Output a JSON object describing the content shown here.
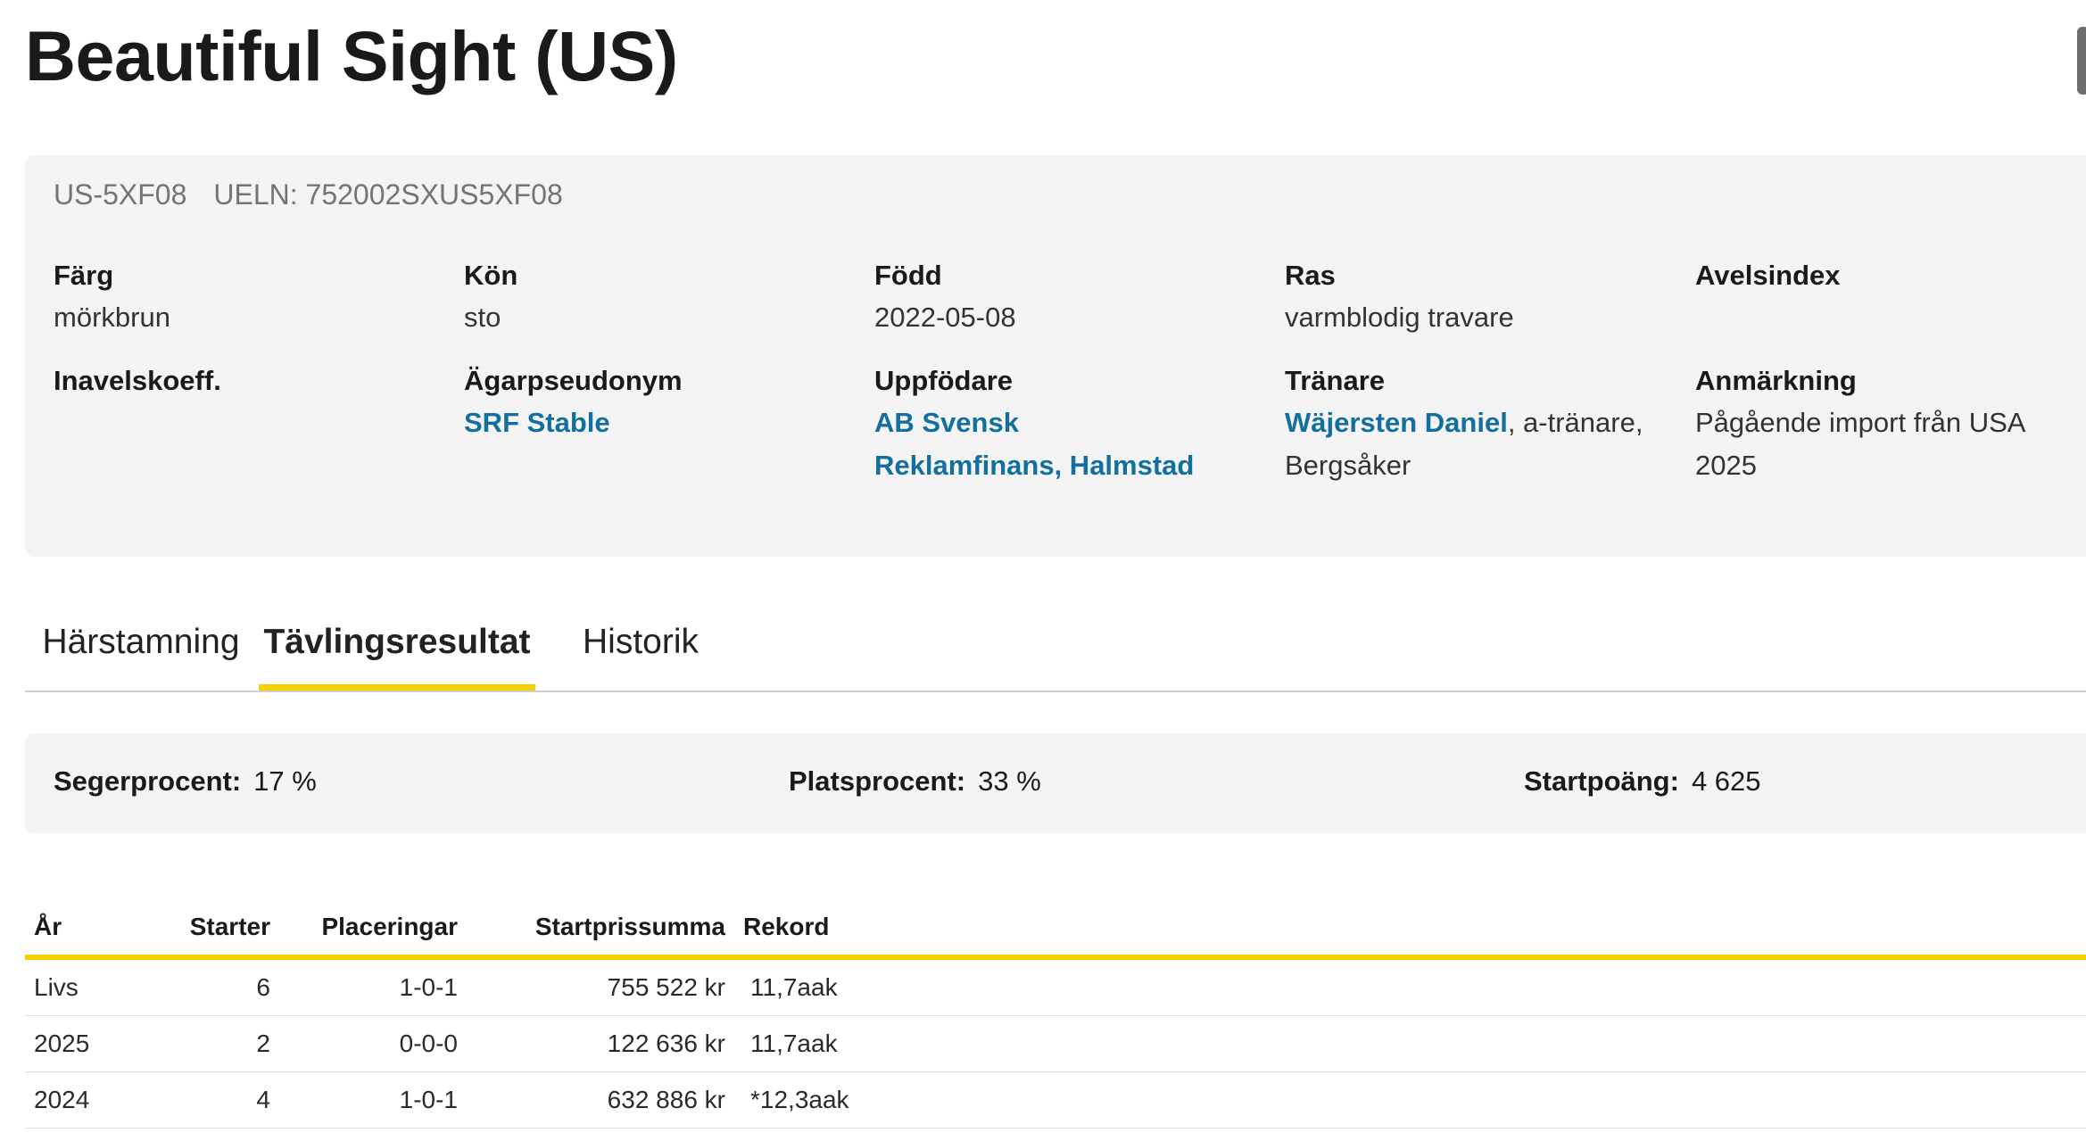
{
  "horse": {
    "name": "Beautiful Sight (US)",
    "reg_no": "US-5XF08",
    "ueln": "UELN: 752002SXUS5XF08"
  },
  "details": {
    "farg": {
      "label": "Färg",
      "value": "mörkbrun"
    },
    "kon": {
      "label": "Kön",
      "value": "sto"
    },
    "fodd": {
      "label": "Född",
      "value": "2022-05-08"
    },
    "ras": {
      "label": "Ras",
      "value": "varmblodig travare"
    },
    "avelsindex": {
      "label": "Avelsindex",
      "value": ""
    },
    "inavel": {
      "label": "Inavelskoeff.",
      "value": ""
    },
    "agarpseudonym": {
      "label": "Ägarpseudonym",
      "link": "SRF Stable"
    },
    "uppfodare": {
      "label": "Uppfödare",
      "link": "AB Svensk Reklamfinans, Halmstad"
    },
    "tranare": {
      "label": "Tränare",
      "link": "Wäjersten Daniel",
      "suffix": ", a-tränare, Bergsåker"
    },
    "anmarkning": {
      "label": "Anmärkning",
      "value": "Pågående import från USA 2025"
    }
  },
  "tabs": [
    "Härstamning",
    "Tävlingsresultat",
    "Historik"
  ],
  "active_tab": "Tävlingsresultat",
  "stats": {
    "seger": {
      "label": "Segerprocent:",
      "value": "17 %"
    },
    "plats": {
      "label": "Platsprocent:",
      "value": "33 %"
    },
    "startpoang": {
      "label": "Startpoäng:",
      "value": "4 625"
    }
  },
  "table": {
    "headers": [
      "År",
      "Starter",
      "Placeringar",
      "Startprissumma",
      "Rekord"
    ],
    "rows": [
      [
        "Livs",
        "6",
        "1-0-1",
        "755 522 kr",
        "11,7aak"
      ],
      [
        "2025",
        "2",
        "0-0-0",
        "122 636 kr",
        "11,7aak"
      ],
      [
        "2024",
        "4",
        "1-0-1",
        "632 886 kr",
        "*12,3aak"
      ]
    ]
  },
  "colors": {
    "accent": "#f5d100",
    "link": "#136f9e",
    "panel": "#f4f4f4"
  }
}
